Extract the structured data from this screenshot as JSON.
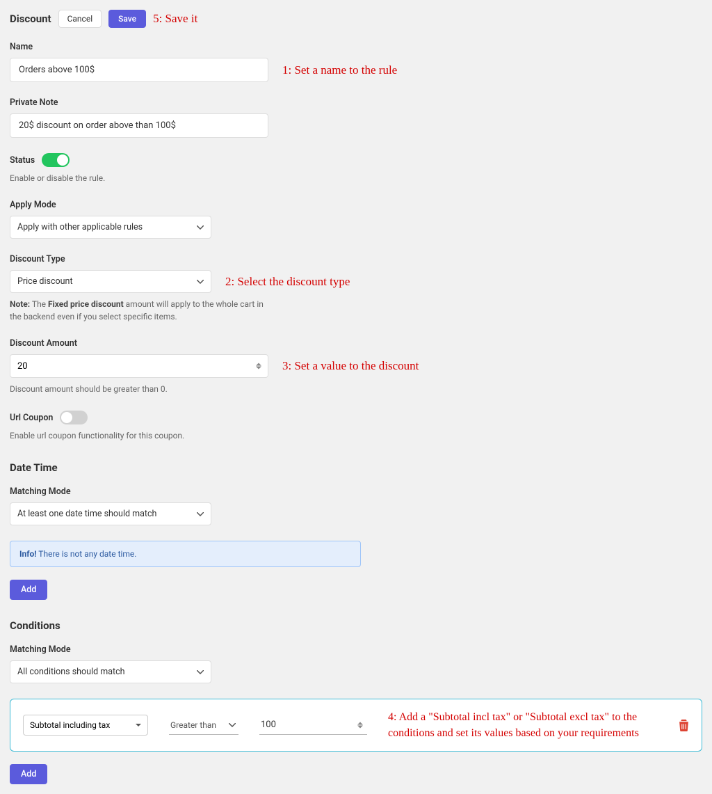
{
  "header": {
    "title": "Discount",
    "cancel_label": "Cancel",
    "save_label": "Save"
  },
  "annotations": {
    "a1": "1: Set a name to the rule",
    "a2": "2: Select the discount type",
    "a3": "3: Set a value to the discount",
    "a4": "4: Add a \"Subtotal incl tax\" or \"Subtotal excl tax\" to the conditions and set its values based on your requirements",
    "a5": "5: Save it"
  },
  "fields": {
    "name": {
      "label": "Name",
      "value": "Orders above 100$"
    },
    "private_note": {
      "label": "Private Note",
      "value": "20$ discount on order above than 100$"
    },
    "status": {
      "label": "Status",
      "help": "Enable or disable the rule.",
      "on": true
    },
    "apply_mode": {
      "label": "Apply Mode",
      "value": "Apply with other applicable rules"
    },
    "discount_type": {
      "label": "Discount Type",
      "value": "Price discount"
    },
    "discount_type_note_prefix": "Note:",
    "discount_type_note_bold": "Fixed price discount",
    "discount_type_note_rest1": " The ",
    "discount_type_note_rest2": " amount will apply to the whole cart in the backend even if you select specific items.",
    "discount_amount": {
      "label": "Discount Amount",
      "value": "20",
      "help": "Discount amount should be greater than 0."
    },
    "url_coupon": {
      "label": "Url Coupon",
      "help": "Enable url coupon functionality for this coupon.",
      "on": false
    }
  },
  "datetime": {
    "section_title": "Date Time",
    "matching_mode_label": "Matching Mode",
    "matching_mode_value": "At least one date time should match",
    "info_bold": "Info!",
    "info_text": " There is not any date time.",
    "add_label": "Add"
  },
  "conditions": {
    "section_title": "Conditions",
    "matching_mode_label": "Matching Mode",
    "matching_mode_value": "All conditions should match",
    "row": {
      "type": "Subtotal including tax",
      "operator": "Greater than",
      "value": "100"
    },
    "add_label": "Add"
  },
  "icons": {
    "trash": "trash-icon"
  }
}
